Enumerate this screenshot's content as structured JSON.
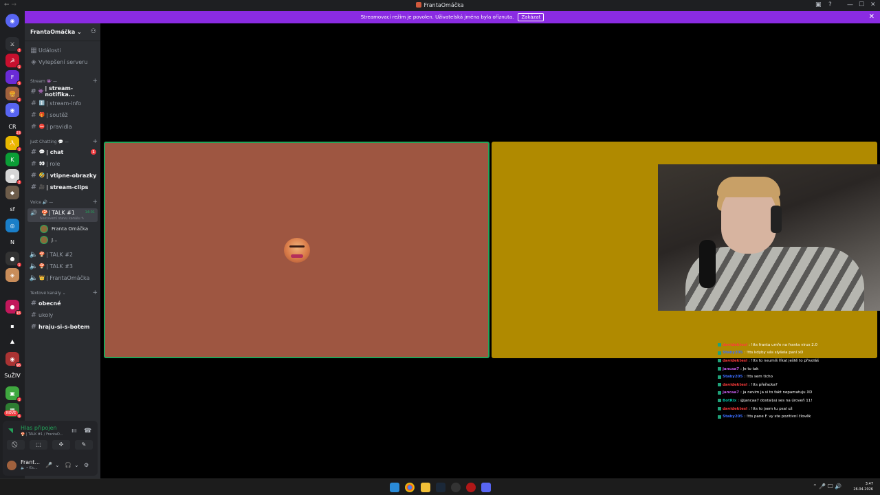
{
  "window": {
    "title": "FrantaOmáčka",
    "back": "←",
    "fwd": "→"
  },
  "banner": {
    "text": "Streamovací režim je povolen. Uživatelská jména byla oříznuta.",
    "button": "Zakázat",
    "close": "✕"
  },
  "server_rail": {
    "items": [
      {
        "label": "⚔",
        "color": "#2b2d31",
        "badge": "2"
      },
      {
        "label": "☭",
        "color": "#c8102e",
        "badge": "1"
      },
      {
        "label": "F",
        "color": "#6a2bd6",
        "badge": "5"
      },
      {
        "label": "🍔",
        "color": "#a0613d",
        "badge": "1"
      },
      {
        "label": "◉",
        "color": "#5865f2",
        "badge": ""
      },
      {
        "label": "CR",
        "color": "#1e1f22",
        "badge": "23"
      },
      {
        "label": "🍌",
        "color": "#e7b800",
        "badge": "1"
      },
      {
        "label": "K",
        "color": "#0b9d36",
        "badge": ""
      },
      {
        "label": "●",
        "color": "#d6d6d6",
        "badge": "2"
      },
      {
        "label": "◆",
        "color": "#6d5c4a",
        "badge": ""
      },
      {
        "label": "sf",
        "color": "#1e1f22",
        "badge": ""
      },
      {
        "label": "◎",
        "color": "#1a7ec8",
        "badge": ""
      },
      {
        "label": "N",
        "color": "#1e1f22",
        "badge": ""
      },
      {
        "label": "●",
        "color": "#333",
        "badge": "1"
      },
      {
        "label": "◈",
        "color": "#c98d5a",
        "badge": ""
      },
      {
        "label": "●",
        "color": "#c2185b",
        "badge": "16"
      },
      {
        "label": "▪",
        "color": "#1e1f22",
        "badge": ""
      },
      {
        "label": "▲",
        "color": "#1e1f22",
        "badge": ""
      },
      {
        "label": "◉",
        "color": "#a33",
        "badge": "96"
      },
      {
        "label": "SuŽIV",
        "color": "#1e1f22",
        "badge": ""
      },
      {
        "label": "▣",
        "color": "#3fa83f",
        "badge": "1"
      },
      {
        "label": "▦",
        "color": "#2e7d32",
        "badge": "6"
      }
    ],
    "new_label": "NOVÉ"
  },
  "server": {
    "name": "FrantaOmáčka ⌄"
  },
  "top_links": [
    {
      "icon": "▦",
      "label": "Události"
    },
    {
      "icon": "◈",
      "label": "Vylepšení serveru"
    }
  ],
  "categories": {
    "stream": "Stream 👾 —",
    "just_chatting": "Just Chatting 💬 —",
    "voice": "Voice 🔊 —",
    "text": "Textové kanály ⌄"
  },
  "channels": {
    "stream": [
      {
        "emoji": "👾",
        "name": "stream-notifika...",
        "bright": true
      },
      {
        "emoji": "ℹ️",
        "name": "stream-info",
        "bright": false
      },
      {
        "emoji": "🎁",
        "name": "soutěž",
        "bright": false
      },
      {
        "emoji": "⛔",
        "name": "pravidla",
        "bright": false
      }
    ],
    "just_chatting": [
      {
        "emoji": "💬",
        "name": "chat",
        "bright": true,
        "unread": "1"
      },
      {
        "emoji": "👀",
        "name": "role",
        "bright": false
      },
      {
        "emoji": "🤣",
        "name": "vtipne-obrazky",
        "bright": true
      },
      {
        "emoji": "🎥",
        "name": "stream-clips",
        "bright": true
      }
    ],
    "voice_active": {
      "name": "| TALK #1",
      "time": "14:01",
      "sub": "Nastavení stavu kanálu ✎"
    },
    "voice_users": [
      "Franta Omáčka",
      "J..."
    ],
    "voice_other": [
      {
        "emoji": "🍄",
        "name": "| TALK #2"
      },
      {
        "emoji": "🍄",
        "name": "| TALK #3"
      },
      {
        "emoji": "👑",
        "name": "| FrantaOmáčka"
      }
    ],
    "text": [
      {
        "name": "obecné",
        "bright": true
      },
      {
        "name": "ukoly",
        "bright": false
      },
      {
        "name": "hraju-si-s-botem",
        "bright": true
      }
    ]
  },
  "voice_panel": {
    "status": "Hlas připojen",
    "sub": "🍄 | TALK #1 / FrantaO...",
    "buttons": [
      "⃠",
      "⬚",
      "✣",
      "✎"
    ]
  },
  "user_panel": {
    "name": "Frant...",
    "status": "🔈 • Kic...",
    "controls": [
      "🎤",
      "⌄",
      "🎧",
      "⌄",
      "⚙"
    ]
  },
  "chat_overlay": [
    {
      "user": "davidektesl",
      "msg": ": !tts franta umře na franta virus 2.0",
      "ucolor": "#ff3b3b",
      "hl": true
    },
    {
      "user": "Staby205",
      "msg": ": !tts kdyby vás slyšela paní xD",
      "ucolor": "#3b6dff",
      "hl": true
    },
    {
      "user": "davidektesl",
      "msg": ": !tts to neumíš říkat ještě to přivoláš",
      "ucolor": "#ff3b3b",
      "hl": false
    },
    {
      "user": "jancaa7",
      "msg": ": Je to tak",
      "ucolor": "#c15be8",
      "hl": false
    },
    {
      "user": "Staby205",
      "msg": ": !tts sem ticho",
      "ucolor": "#3b6dff",
      "hl": false
    },
    {
      "user": "davidektesl",
      "msg": ": !tts přeřacka?",
      "ucolor": "#ff3b3b",
      "hl": false
    },
    {
      "user": "jancaa7",
      "msg": ": ja nevim ja si to fakt nepamatuju XD",
      "ucolor": "#c15be8",
      "hl": false
    },
    {
      "user": "BotRix",
      "msg": ": @jancaa7 dostal(a) ses na úroveň 11!",
      "ucolor": "#00c2a8",
      "hl": false
    },
    {
      "user": "davidektesl",
      "msg": ": !tts to jsem tu psal už",
      "ucolor": "#ff3b3b",
      "hl": false
    },
    {
      "user": "Staby205",
      "msg": ": !tts pane F. vy ste pozitivní člověk",
      "ucolor": "#3b6dff",
      "hl": false
    }
  ],
  "taskbar": {
    "time": "3:47",
    "date": "26.04.2026",
    "tray": "⌃  🎤  🖵  🔊"
  },
  "colors": {
    "accent": "#8a2be2",
    "green": "#23a55a",
    "tile1": "#9e5641",
    "tile2": "#b08a00"
  }
}
